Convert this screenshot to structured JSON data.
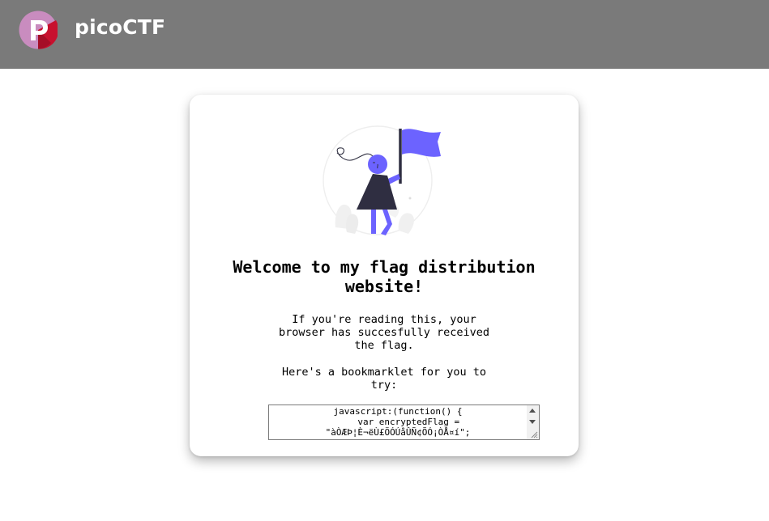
{
  "header": {
    "brand": "picoCTF",
    "bar_color": "#7a7a7a",
    "logo_icon": "picoctf-logo-icon"
  },
  "card": {
    "illustration": "woman-holding-flag-illustration",
    "accent_color": "#6c63ff",
    "title": "Welcome to my flag distribution website!",
    "paragraph1": "If you're reading this, your browser has succesfully received the flag.",
    "paragraph2": "Here's a bookmarklet for you to try:",
    "bookmarklet": {
      "line1": "javascript:(function() {",
      "line2": "    var encryptedFlag =",
      "line3": "\"àÒÆÞ¦È¬ëÙ£ÖÓÚåÛÑ¢ÕÓ¡ÒÅ¤í\";"
    }
  }
}
